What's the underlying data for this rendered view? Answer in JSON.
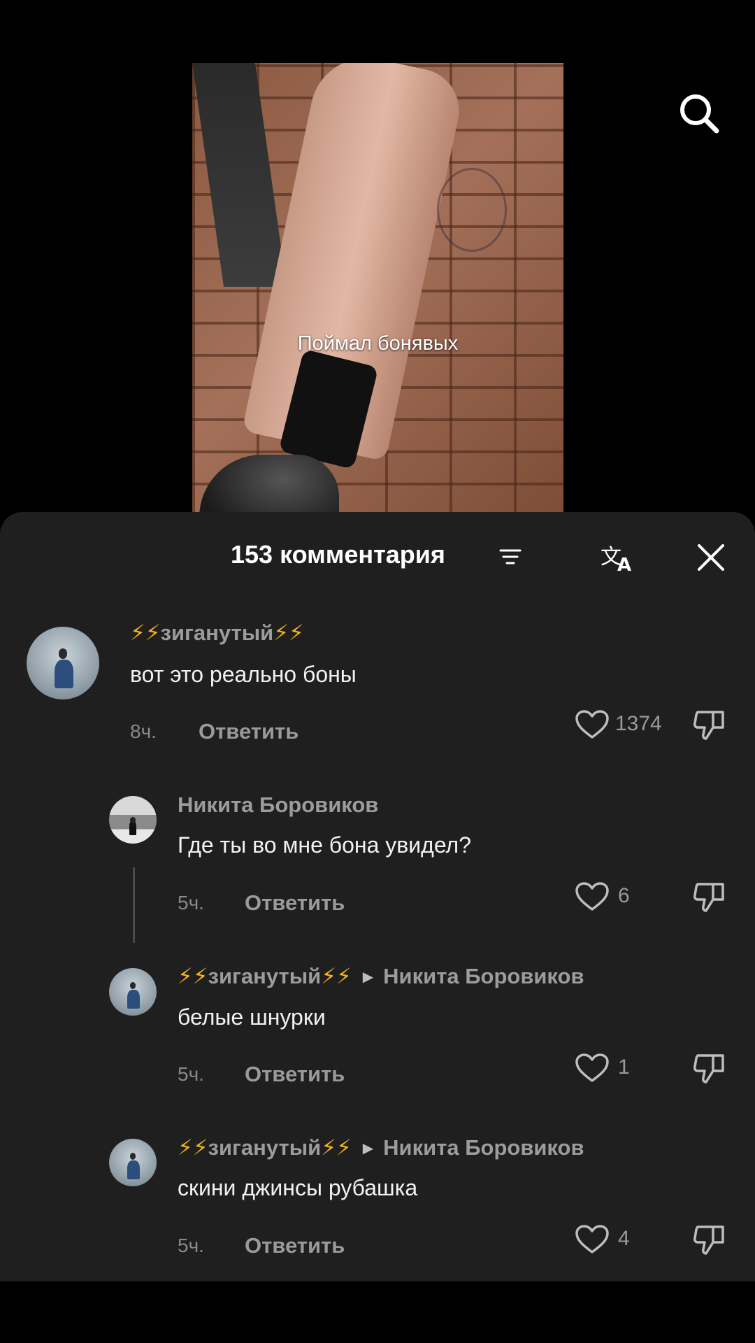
{
  "video": {
    "caption": "Поймал бонявых"
  },
  "header": {
    "search_icon": "search-icon"
  },
  "comments_sheet": {
    "title": "153 комментария",
    "sort_icon": "sort-lines-icon",
    "translate_icon": "translate-icon",
    "close_icon": "close-icon",
    "comments": [
      {
        "username": "зиганутый",
        "username_decoration": "⚡⚡",
        "text": "вот это реально боны",
        "time": "8ч.",
        "reply_label": "Ответить",
        "likes": "1374"
      }
    ],
    "replies": [
      {
        "username": "Никита Боровиков",
        "text": "Где ты во мне бона увидел?",
        "time": "5ч.",
        "reply_label": "Ответить",
        "likes": "6"
      },
      {
        "username": "зиганутый",
        "username_decoration": "⚡⚡",
        "reply_to": "Никита Боровиков",
        "text": "белые шнурки",
        "time": "5ч.",
        "reply_label": "Ответить",
        "likes": "1"
      },
      {
        "username": "зиганутый",
        "username_decoration": "⚡⚡",
        "reply_to": "Никита Боровиков",
        "text": "скини джинсы рубашка",
        "time": "5ч.",
        "reply_label": "Ответить",
        "likes": "4"
      }
    ]
  },
  "colors": {
    "sheet_background": "#1f1f1f",
    "username": "#9c9c9c",
    "bolt": "#f2b31f",
    "text": "#f2f2f2"
  }
}
